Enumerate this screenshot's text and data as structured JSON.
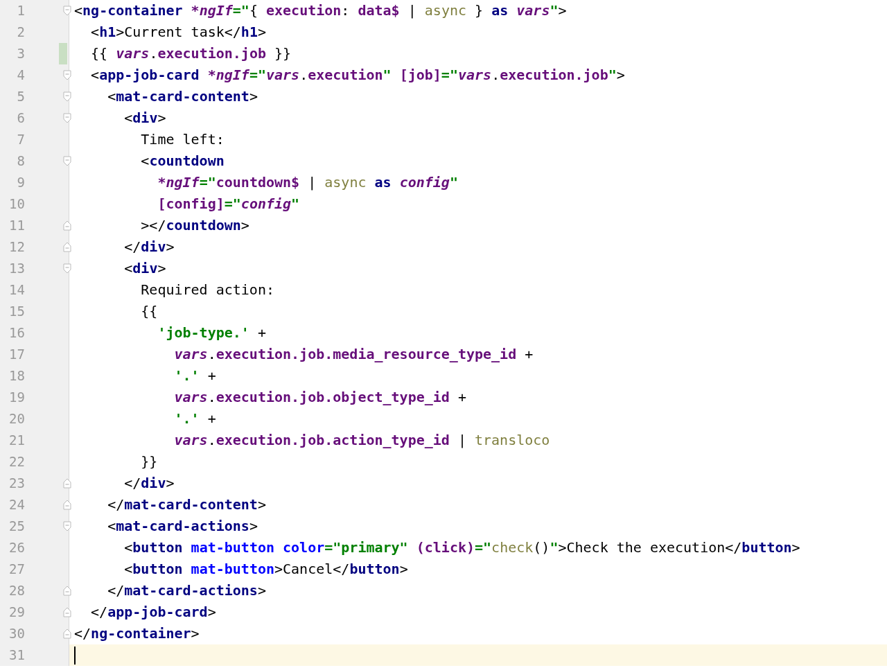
{
  "editor": {
    "lines": [
      {
        "number": "1",
        "fold_start": true,
        "tokens": [
          {
            "kind": "plain",
            "text": "<"
          },
          {
            "kind": "tag",
            "text": "ng-container"
          },
          {
            "kind": "directive",
            "text": " *ngIf"
          },
          {
            "kind": "quote",
            "text": "=\""
          },
          {
            "kind": "plain",
            "text": "{ "
          },
          {
            "kind": "prop",
            "text": "execution"
          },
          {
            "kind": "plain",
            "text": ": "
          },
          {
            "kind": "prop",
            "text": "data$"
          },
          {
            "kind": "plain",
            "text": " | "
          },
          {
            "kind": "pipe",
            "text": "async"
          },
          {
            "kind": "plain",
            "text": " } "
          },
          {
            "kind": "keyword",
            "text": "as"
          },
          {
            "kind": "var",
            "text": " vars"
          },
          {
            "kind": "quote",
            "text": "\""
          },
          {
            "kind": "plain",
            "text": ">"
          }
        ]
      },
      {
        "number": "2",
        "tokens": [
          {
            "kind": "plain",
            "text": "  <"
          },
          {
            "kind": "tag",
            "text": "h1"
          },
          {
            "kind": "plain",
            "text": ">Current task</"
          },
          {
            "kind": "tag",
            "text": "h1"
          },
          {
            "kind": "plain",
            "text": ">"
          }
        ]
      },
      {
        "number": "3",
        "changed": true,
        "tokens": [
          {
            "kind": "plain",
            "text": "  {{ "
          },
          {
            "kind": "var",
            "text": "vars"
          },
          {
            "kind": "plain",
            "text": "."
          },
          {
            "kind": "prop",
            "text": "execution.job"
          },
          {
            "kind": "plain",
            "text": " }}"
          }
        ]
      },
      {
        "number": "4",
        "fold_start": true,
        "tokens": [
          {
            "kind": "plain",
            "text": "  <"
          },
          {
            "kind": "tag",
            "text": "app-job-card"
          },
          {
            "kind": "directive",
            "text": " *ngIf"
          },
          {
            "kind": "quote",
            "text": "=\""
          },
          {
            "kind": "var",
            "text": "vars"
          },
          {
            "kind": "plain",
            "text": "."
          },
          {
            "kind": "prop",
            "text": "execution"
          },
          {
            "kind": "quote",
            "text": "\""
          },
          {
            "kind": "binding",
            "text": " [job]"
          },
          {
            "kind": "quote",
            "text": "=\""
          },
          {
            "kind": "var",
            "text": "vars"
          },
          {
            "kind": "plain",
            "text": "."
          },
          {
            "kind": "prop",
            "text": "execution.job"
          },
          {
            "kind": "quote",
            "text": "\""
          },
          {
            "kind": "plain",
            "text": ">"
          }
        ]
      },
      {
        "number": "5",
        "fold_start": true,
        "tokens": [
          {
            "kind": "plain",
            "text": "    <"
          },
          {
            "kind": "tag",
            "text": "mat-card-content"
          },
          {
            "kind": "plain",
            "text": ">"
          }
        ]
      },
      {
        "number": "6",
        "fold_start": true,
        "tokens": [
          {
            "kind": "plain",
            "text": "      <"
          },
          {
            "kind": "tag",
            "text": "div"
          },
          {
            "kind": "plain",
            "text": ">"
          }
        ]
      },
      {
        "number": "7",
        "tokens": [
          {
            "kind": "plain",
            "text": "        Time left:"
          }
        ]
      },
      {
        "number": "8",
        "fold_start": true,
        "tokens": [
          {
            "kind": "plain",
            "text": "        <"
          },
          {
            "kind": "tag",
            "text": "countdown"
          }
        ]
      },
      {
        "number": "9",
        "tokens": [
          {
            "kind": "directive",
            "text": "          *ngIf"
          },
          {
            "kind": "quote",
            "text": "=\""
          },
          {
            "kind": "prop",
            "text": "countdown$"
          },
          {
            "kind": "plain",
            "text": " | "
          },
          {
            "kind": "pipe",
            "text": "async"
          },
          {
            "kind": "keyword",
            "text": " as"
          },
          {
            "kind": "var",
            "text": " config"
          },
          {
            "kind": "quote",
            "text": "\""
          }
        ]
      },
      {
        "number": "10",
        "tokens": [
          {
            "kind": "binding",
            "text": "          [config]"
          },
          {
            "kind": "quote",
            "text": "=\""
          },
          {
            "kind": "var",
            "text": "config"
          },
          {
            "kind": "quote",
            "text": "\""
          }
        ]
      },
      {
        "number": "11",
        "fold_end": true,
        "tokens": [
          {
            "kind": "plain",
            "text": "        ></"
          },
          {
            "kind": "tag",
            "text": "countdown"
          },
          {
            "kind": "plain",
            "text": ">"
          }
        ]
      },
      {
        "number": "12",
        "fold_end": true,
        "tokens": [
          {
            "kind": "plain",
            "text": "      </"
          },
          {
            "kind": "tag",
            "text": "div"
          },
          {
            "kind": "plain",
            "text": ">"
          }
        ]
      },
      {
        "number": "13",
        "fold_start": true,
        "tokens": [
          {
            "kind": "plain",
            "text": "      <"
          },
          {
            "kind": "tag",
            "text": "div"
          },
          {
            "kind": "plain",
            "text": ">"
          }
        ]
      },
      {
        "number": "14",
        "tokens": [
          {
            "kind": "plain",
            "text": "        Required action:"
          }
        ]
      },
      {
        "number": "15",
        "tokens": [
          {
            "kind": "plain",
            "text": "        {{"
          }
        ]
      },
      {
        "number": "16",
        "tokens": [
          {
            "kind": "literal",
            "text": "          'job-type.'"
          },
          {
            "kind": "plain",
            "text": " +"
          }
        ]
      },
      {
        "number": "17",
        "tokens": [
          {
            "kind": "var",
            "text": "            vars"
          },
          {
            "kind": "plain",
            "text": "."
          },
          {
            "kind": "prop",
            "text": "execution.job.media_resource_type_id"
          },
          {
            "kind": "plain",
            "text": " +"
          }
        ]
      },
      {
        "number": "18",
        "tokens": [
          {
            "kind": "literal",
            "text": "            '.'"
          },
          {
            "kind": "plain",
            "text": " +"
          }
        ]
      },
      {
        "number": "19",
        "tokens": [
          {
            "kind": "var",
            "text": "            vars"
          },
          {
            "kind": "plain",
            "text": "."
          },
          {
            "kind": "prop",
            "text": "execution.job.object_type_id"
          },
          {
            "kind": "plain",
            "text": " +"
          }
        ]
      },
      {
        "number": "20",
        "tokens": [
          {
            "kind": "literal",
            "text": "            '.'"
          },
          {
            "kind": "plain",
            "text": " +"
          }
        ]
      },
      {
        "number": "21",
        "tokens": [
          {
            "kind": "var",
            "text": "            vars"
          },
          {
            "kind": "plain",
            "text": "."
          },
          {
            "kind": "prop",
            "text": "execution.job.action_type_id"
          },
          {
            "kind": "plain",
            "text": " | "
          },
          {
            "kind": "pipe",
            "text": "transloco"
          }
        ]
      },
      {
        "number": "22",
        "tokens": [
          {
            "kind": "plain",
            "text": "        }}"
          }
        ]
      },
      {
        "number": "23",
        "fold_end": true,
        "tokens": [
          {
            "kind": "plain",
            "text": "      </"
          },
          {
            "kind": "tag",
            "text": "div"
          },
          {
            "kind": "plain",
            "text": ">"
          }
        ]
      },
      {
        "number": "24",
        "fold_end": true,
        "tokens": [
          {
            "kind": "plain",
            "text": "    </"
          },
          {
            "kind": "tag",
            "text": "mat-card-content"
          },
          {
            "kind": "plain",
            "text": ">"
          }
        ]
      },
      {
        "number": "25",
        "fold_start": true,
        "tokens": [
          {
            "kind": "plain",
            "text": "    <"
          },
          {
            "kind": "tag",
            "text": "mat-card-actions"
          },
          {
            "kind": "plain",
            "text": ">"
          }
        ]
      },
      {
        "number": "26",
        "tokens": [
          {
            "kind": "plain",
            "text": "      <"
          },
          {
            "kind": "tag",
            "text": "button"
          },
          {
            "kind": "attr",
            "text": " mat-button"
          },
          {
            "kind": "attr",
            "text": " color"
          },
          {
            "kind": "quote",
            "text": "=\"primary\""
          },
          {
            "kind": "binding",
            "text": " (click)"
          },
          {
            "kind": "quote",
            "text": "=\""
          },
          {
            "kind": "pipe",
            "text": "check"
          },
          {
            "kind": "plain",
            "text": "()"
          },
          {
            "kind": "quote",
            "text": "\""
          },
          {
            "kind": "plain",
            "text": ">Check the execution</"
          },
          {
            "kind": "tag",
            "text": "button"
          },
          {
            "kind": "plain",
            "text": ">"
          }
        ]
      },
      {
        "number": "27",
        "tokens": [
          {
            "kind": "plain",
            "text": "      <"
          },
          {
            "kind": "tag",
            "text": "button"
          },
          {
            "kind": "attr",
            "text": " mat-button"
          },
          {
            "kind": "plain",
            "text": ">Cancel</"
          },
          {
            "kind": "tag",
            "text": "button"
          },
          {
            "kind": "plain",
            "text": ">"
          }
        ]
      },
      {
        "number": "28",
        "fold_end": true,
        "tokens": [
          {
            "kind": "plain",
            "text": "    </"
          },
          {
            "kind": "tag",
            "text": "mat-card-actions"
          },
          {
            "kind": "plain",
            "text": ">"
          }
        ]
      },
      {
        "number": "29",
        "fold_end": true,
        "tokens": [
          {
            "kind": "plain",
            "text": "  </"
          },
          {
            "kind": "tag",
            "text": "app-job-card"
          },
          {
            "kind": "plain",
            "text": ">"
          }
        ]
      },
      {
        "number": "30",
        "fold_end": true,
        "tokens": [
          {
            "kind": "plain",
            "text": "</"
          },
          {
            "kind": "tag",
            "text": "ng-container"
          },
          {
            "kind": "plain",
            "text": ">"
          }
        ]
      },
      {
        "number": "31",
        "current": true
      }
    ]
  }
}
